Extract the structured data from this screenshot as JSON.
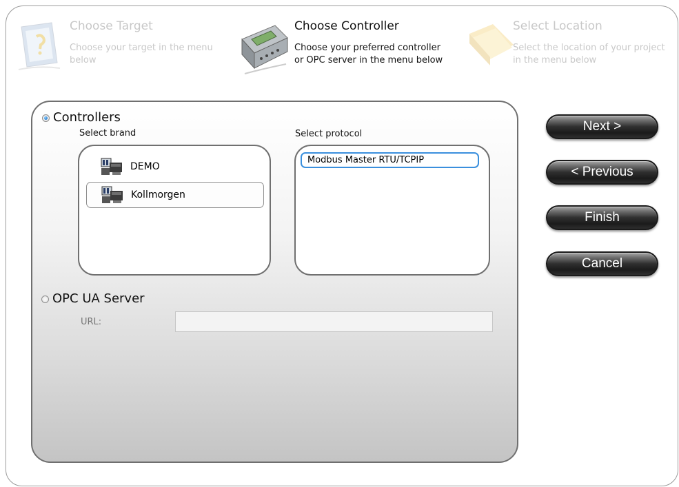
{
  "steps": [
    {
      "title": "Choose Target",
      "description_line1": "Choose your target in the menu",
      "description_line2": "below",
      "state": "inactive",
      "icon": "target-icon"
    },
    {
      "title": "Choose Controller",
      "description_line1": "Choose your preferred controller",
      "description_line2": "or OPC server in the menu below",
      "state": "active",
      "icon": "controller-icon"
    },
    {
      "title": "Select Location",
      "description_line1": "Select the location of your project",
      "description_line2": "in the menu below",
      "state": "inactive",
      "icon": "folder-icon"
    }
  ],
  "controllers": {
    "label": "Controllers",
    "selected": true,
    "brand_label": "Select brand",
    "protocol_label": "Select protocol",
    "brands": [
      {
        "label": "DEMO",
        "icon": "plc-icon",
        "selected": false
      },
      {
        "label": "Kollmorgen",
        "icon": "plc-icon",
        "selected": true
      }
    ],
    "protocols": [
      {
        "label": "Modbus Master RTU/TCPIP",
        "selected": true
      }
    ]
  },
  "opc": {
    "label": "OPC UA Server",
    "selected": false,
    "url_label": "URL:",
    "url_value": ""
  },
  "buttons": {
    "next": "Next >",
    "previous": "< Previous",
    "finish": "Finish",
    "cancel": "Cancel"
  },
  "colors": {
    "selection_border": "#3a8fdd",
    "button_dark": "#1b1b1b",
    "inactive_text": "#c8c8c8"
  }
}
